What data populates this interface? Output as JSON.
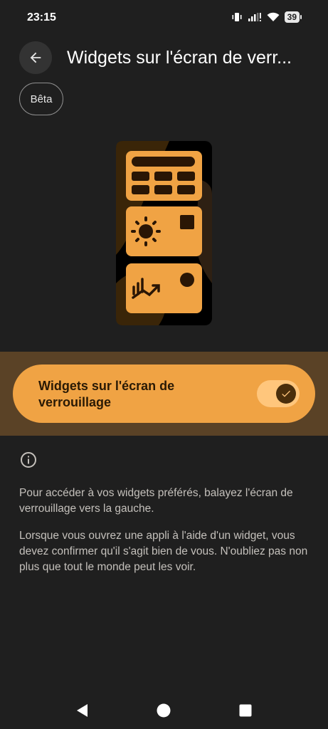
{
  "status_bar": {
    "time": "23:15",
    "battery": "39",
    "icons": [
      "vibrate-icon",
      "signal-icon",
      "wifi-icon",
      "battery-icon"
    ]
  },
  "header": {
    "title": "Widgets sur l'écran de verr...",
    "badge": "Bêta",
    "back_icon": "arrow-back-icon"
  },
  "toggle": {
    "label": "Widgets sur l'écran de verrouillage",
    "checked": true
  },
  "info": {
    "icon": "info-icon",
    "paragraphs": [
      "Pour accéder à vos widgets préférés, balayez l'écran de verrouillage vers la gauche.",
      "Lorsque vous ouvrez une appli à l'aide d'un widget, vous devez confirmer qu'il s'agit bien de vous. N'oubliez pas non plus que tout le monde peut les voir."
    ]
  },
  "nav": [
    "back-triangle-icon",
    "home-circle-icon",
    "recents-square-icon"
  ],
  "colors": {
    "background": "#1f1f1f",
    "accent": "#f0a344",
    "band": "#5a4226",
    "switch_track": "#ffc67c",
    "switch_thumb": "#4a2e0b"
  }
}
